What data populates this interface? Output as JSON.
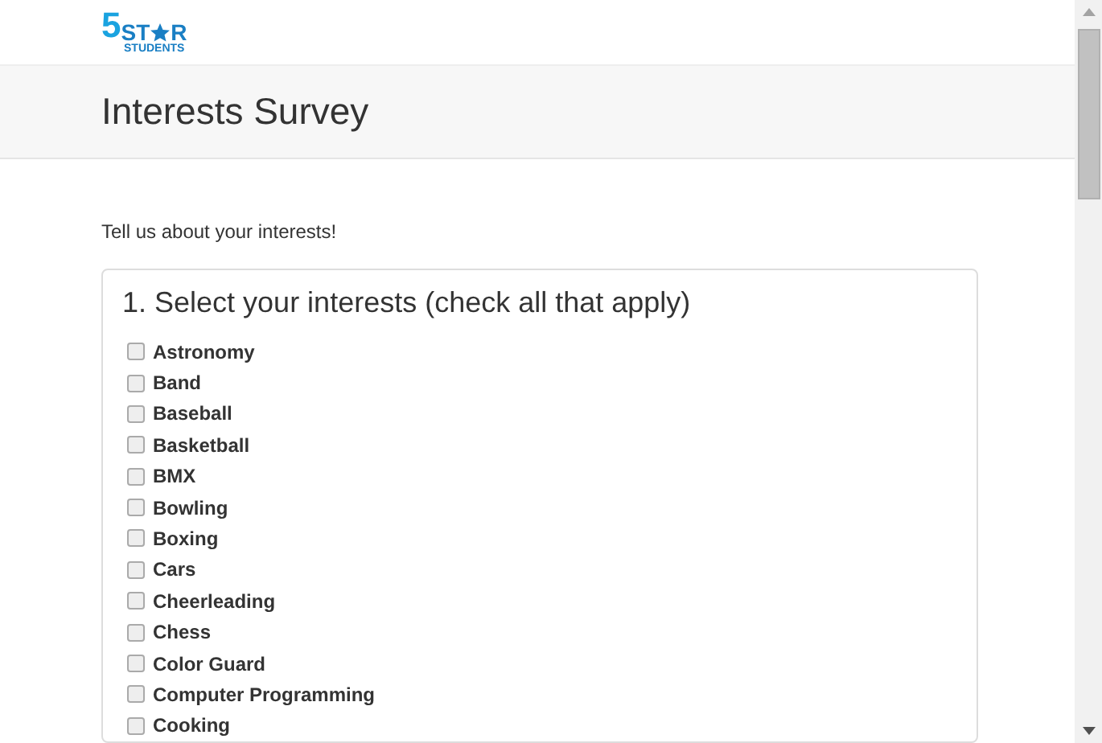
{
  "logo": {
    "number": "5",
    "word_start": "ST",
    "word_end": "R",
    "subtitle": "STUDENTS"
  },
  "page_title": "Interests Survey",
  "intro": "Tell us about your interests!",
  "question": {
    "title": "1. Select your interests (check all that apply)",
    "options": [
      {
        "label": "Astronomy",
        "checked": false
      },
      {
        "label": "Band",
        "checked": false
      },
      {
        "label": "Baseball",
        "checked": false
      },
      {
        "label": "Basketball",
        "checked": false
      },
      {
        "label": "BMX",
        "checked": false
      },
      {
        "label": "Bowling",
        "checked": false
      },
      {
        "label": "Boxing",
        "checked": false
      },
      {
        "label": "Cars",
        "checked": false
      },
      {
        "label": "Cheerleading",
        "checked": false
      },
      {
        "label": "Chess",
        "checked": false
      },
      {
        "label": "Color Guard",
        "checked": false
      },
      {
        "label": "Computer Programming",
        "checked": false
      },
      {
        "label": "Cooking",
        "checked": false
      }
    ]
  }
}
